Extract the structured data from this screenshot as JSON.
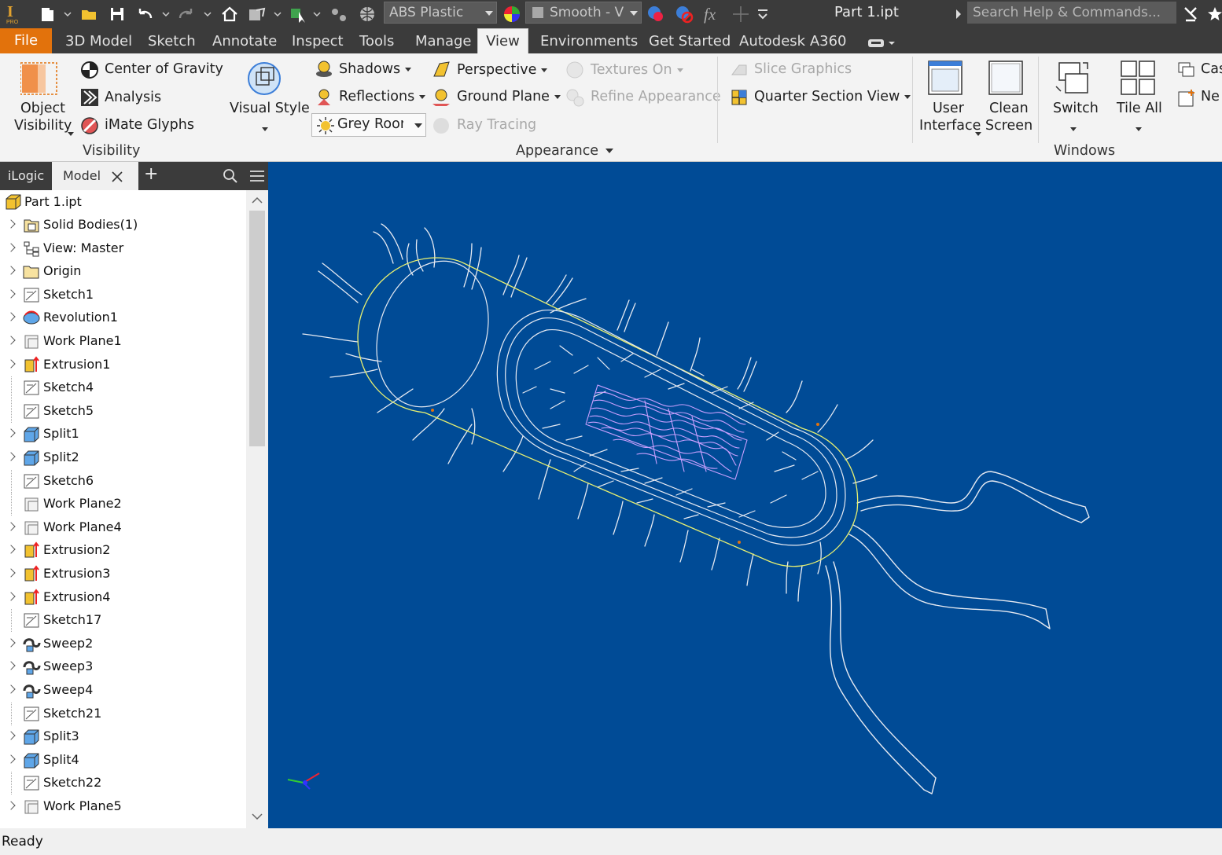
{
  "app": {
    "title": "Part 1.ipt",
    "material": "ABS Plastic",
    "appearance": "Smooth - V",
    "search_placeholder": "Search Help & Commands...",
    "function_symbol": "fx"
  },
  "menu": {
    "file": "File",
    "tabs": [
      "3D Model",
      "Sketch",
      "Annotate",
      "Inspect",
      "Tools",
      "Manage",
      "View",
      "Environments",
      "Get Started",
      "Autodesk A360"
    ],
    "active_tab": "View"
  },
  "ribbon": {
    "visibility": {
      "object_visibility_1": "Object",
      "object_visibility_2": "Visibility",
      "center_of_gravity": "Center of Gravity",
      "analysis": "Analysis",
      "imate_glyphs": "iMate Glyphs",
      "panel_label": "Visibility"
    },
    "appearance": {
      "visual_style": "Visual Style",
      "shadows": "Shadows",
      "reflections": "Reflections",
      "lighting": "Grey Room",
      "perspective": "Perspective",
      "ground_plane": "Ground Plane",
      "ray_tracing": "Ray Tracing",
      "textures_on": "Textures On",
      "refine_appearance": "Refine Appearance",
      "slice_graphics": "Slice Graphics",
      "quarter_section_view": "Quarter Section View",
      "panel_label": "Appearance"
    },
    "windows": {
      "user_interface_1": "User",
      "user_interface_2": "Interface",
      "clean_screen_1": "Clean",
      "clean_screen_2": "Screen",
      "switch": "Switch",
      "tile_all": "Tile All",
      "cascade": "Cas",
      "new_window": "Ne",
      "panel_label": "Windows"
    }
  },
  "browser": {
    "tab_ilogic": "iLogic",
    "tab_model": "Model",
    "add_tab": "+",
    "root": "Part 1.ipt",
    "items": [
      {
        "label": "Solid Bodies(1)",
        "icon": "solid-bodies-icon",
        "expandable": true
      },
      {
        "label": "View: Master",
        "icon": "view-rep-icon",
        "expandable": true
      },
      {
        "label": "Origin",
        "icon": "folder-icon",
        "expandable": true
      },
      {
        "label": "Sketch1",
        "icon": "sketch-icon",
        "expandable": true
      },
      {
        "label": "Revolution1",
        "icon": "revolve-icon",
        "expandable": true
      },
      {
        "label": "Work Plane1",
        "icon": "work-plane-icon",
        "expandable": true
      },
      {
        "label": "Extrusion1",
        "icon": "extrude-icon",
        "expandable": true
      },
      {
        "label": "Sketch4",
        "icon": "sketch-icon",
        "expandable": false
      },
      {
        "label": "Sketch5",
        "icon": "sketch-icon",
        "expandable": false
      },
      {
        "label": "Split1",
        "icon": "split-icon",
        "expandable": true
      },
      {
        "label": "Split2",
        "icon": "split-icon",
        "expandable": true
      },
      {
        "label": "Sketch6",
        "icon": "sketch-icon",
        "expandable": false
      },
      {
        "label": "Work Plane2",
        "icon": "work-plane-icon",
        "expandable": false
      },
      {
        "label": "Work Plane4",
        "icon": "work-plane-icon",
        "expandable": true
      },
      {
        "label": "Extrusion2",
        "icon": "extrude-icon",
        "expandable": true
      },
      {
        "label": "Extrusion3",
        "icon": "extrude-icon",
        "expandable": true
      },
      {
        "label": "Extrusion4",
        "icon": "extrude-icon",
        "expandable": true
      },
      {
        "label": "Sketch17",
        "icon": "sketch-icon",
        "expandable": false
      },
      {
        "label": "Sweep2",
        "icon": "sweep-icon",
        "expandable": true
      },
      {
        "label": "Sweep3",
        "icon": "sweep-icon",
        "expandable": true
      },
      {
        "label": "Sweep4",
        "icon": "sweep-icon",
        "expandable": true
      },
      {
        "label": "Sketch21",
        "icon": "sketch-icon",
        "expandable": false
      },
      {
        "label": "Split3",
        "icon": "split-icon",
        "expandable": true
      },
      {
        "label": "Split4",
        "icon": "split-icon",
        "expandable": true
      },
      {
        "label": "Sketch22",
        "icon": "sketch-icon",
        "expandable": false
      },
      {
        "label": "Work Plane5",
        "icon": "work-plane-icon",
        "expandable": true
      }
    ]
  },
  "status": {
    "text": "Ready"
  },
  "colors": {
    "viewport_bg": "#004b96",
    "wire": "#e6eaf2",
    "membrane": "#e8f070",
    "dna": "#c9a0ff",
    "file_orange": "#e2720c",
    "dark_chrome": "#3b3b3b"
  }
}
